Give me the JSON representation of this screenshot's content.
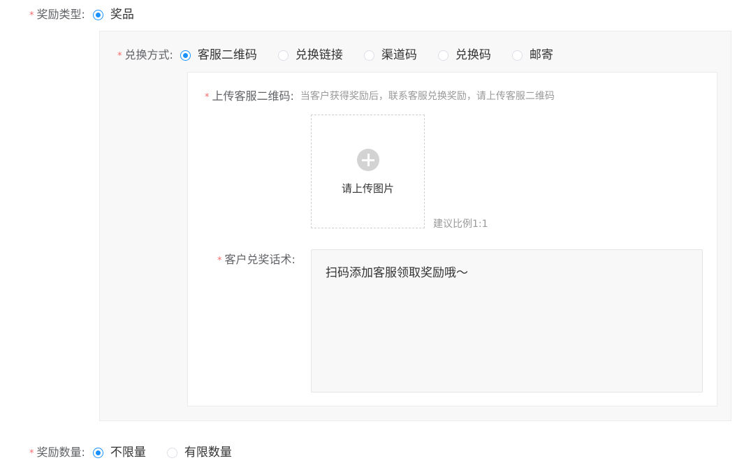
{
  "reward_type": {
    "label": "奖励类型:",
    "options": [
      {
        "label": "奖品",
        "checked": true
      }
    ]
  },
  "redeem_method": {
    "label": "兑换方式:",
    "options": [
      {
        "label": "客服二维码",
        "checked": true
      },
      {
        "label": "兑换链接",
        "checked": false
      },
      {
        "label": "渠道码",
        "checked": false
      },
      {
        "label": "兑换码",
        "checked": false
      },
      {
        "label": "邮寄",
        "checked": false
      }
    ]
  },
  "qr_upload": {
    "label": "上传客服二维码:",
    "hint": "当客户获得奖励后，联系客服兑换奖励，请上传客服二维码",
    "button_text": "请上传图片",
    "ratio_hint": "建议比例1:1"
  },
  "redeem_script": {
    "label": "客户兑奖话术:",
    "value": "扫码添加客服领取奖励哦～"
  },
  "reward_quantity": {
    "label": "奖励数量:",
    "options": [
      {
        "label": "不限量",
        "checked": true
      },
      {
        "label": "有限数量",
        "checked": false
      }
    ]
  },
  "required_mark": "*"
}
